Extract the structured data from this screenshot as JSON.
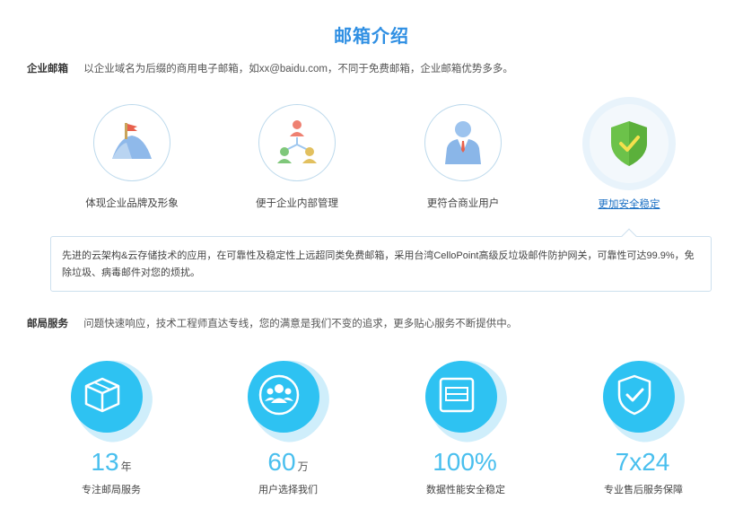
{
  "page_title": "邮箱介绍",
  "enterprise": {
    "label": "企业邮箱",
    "text": "以企业域名为后缀的商用电子邮箱，如xx@baidu.com，不同于免费邮箱，企业邮箱优势多多。"
  },
  "features": [
    {
      "name": "体现企业品牌及形象",
      "icon": "flag-on-hill-icon",
      "active": false
    },
    {
      "name": "便于企业内部管理",
      "icon": "org-chart-icon",
      "active": false
    },
    {
      "name": "更符合商业用户",
      "icon": "businessman-icon",
      "active": false
    },
    {
      "name": "更加安全稳定",
      "icon": "shield-check-icon",
      "active": true
    }
  ],
  "description": "先进的云架构&云存储技术的应用，在可靠性及稳定性上远超同类免费邮箱，采用台湾CelloPoint高级反垃圾邮件防护网关，可靠性可达99.9%，免除垃圾、病毒邮件对您的烦扰。",
  "service": {
    "label": "邮局服务",
    "text": "问题快速响应，技术工程师直达专线，您的满意是我们不变的追求，更多贴心服务不断提供中。"
  },
  "stats": [
    {
      "number": "13",
      "unit": "年",
      "caption": "专注邮局服务",
      "icon": "box-icon"
    },
    {
      "number": "60",
      "unit": "万",
      "caption": "用户选择我们",
      "icon": "users-icon"
    },
    {
      "number": "100%",
      "unit": "",
      "caption": "数据性能安全稳定",
      "icon": "server-icon"
    },
    {
      "number": "7x24",
      "unit": "",
      "caption": "专业售后服务保障",
      "icon": "shield-icon"
    }
  ],
  "colors": {
    "title_blue": "#2f8fe3",
    "stat_blue": "#2ec2f2",
    "shield_green": "#6cc24a"
  }
}
